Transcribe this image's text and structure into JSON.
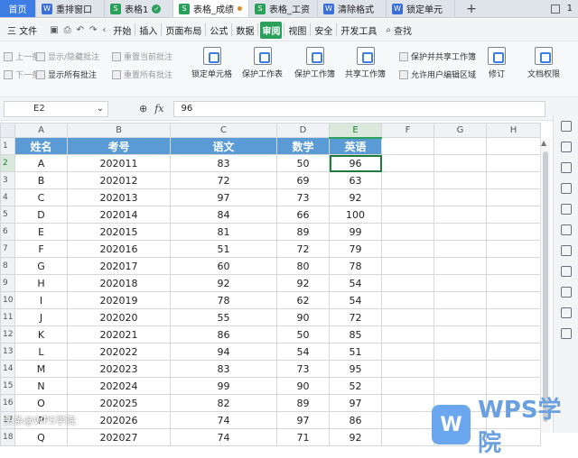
{
  "tabs": [
    {
      "label": "首页",
      "type": "home"
    },
    {
      "label": "重排窗口",
      "icon": "W",
      "kind": "w"
    },
    {
      "label": "表格1",
      "icon": "S",
      "kind": "s",
      "badge": "ok"
    },
    {
      "label": "表格_成绩",
      "icon": "S",
      "kind": "s",
      "active": true,
      "dot": true
    },
    {
      "label": "表格_工资",
      "icon": "S",
      "kind": "s"
    },
    {
      "label": "清除格式",
      "icon": "W",
      "kind": "w"
    },
    {
      "label": "锁定单元",
      "icon": "W",
      "kind": "w"
    }
  ],
  "tab_add": "+",
  "window_badge": "1",
  "menu": {
    "file": "三 文件",
    "items": [
      "开始",
      "插入",
      "页面布局",
      "公式",
      "数据",
      "审阅",
      "视图",
      "安全",
      "开发工具"
    ],
    "active": "审阅",
    "search": "查找"
  },
  "ribbon": {
    "small": [
      {
        "label": "上一条",
        "on": false
      },
      {
        "label": "下一条",
        "on": false
      },
      {
        "label": "显示/隐藏批注",
        "on": false
      },
      {
        "label": "显示所有批注",
        "on": true
      },
      {
        "label": "重置当前批注",
        "on": false
      },
      {
        "label": "重置所有批注",
        "on": false
      },
      {
        "label": "保护并共享工作簿",
        "on": true
      },
      {
        "label": "允许用户编辑区域",
        "on": true
      }
    ],
    "big": [
      "锁定单元格",
      "保护工作表",
      "保护工作簿",
      "共享工作簿",
      "修订",
      "文档权限"
    ]
  },
  "formula_bar": {
    "cell": "E2",
    "fx": "fx",
    "value": "96"
  },
  "columns": [
    "A",
    "B",
    "C",
    "D",
    "E",
    "F",
    "G",
    "H"
  ],
  "selected_col": "E",
  "headers": [
    "姓名",
    "考号",
    "语文",
    "数学",
    "英语"
  ],
  "rows": [
    [
      "A",
      "202011",
      "83",
      "50",
      "96"
    ],
    [
      "B",
      "202012",
      "72",
      "69",
      "63"
    ],
    [
      "C",
      "202013",
      "97",
      "73",
      "92"
    ],
    [
      "D",
      "202014",
      "84",
      "66",
      "100"
    ],
    [
      "E",
      "202015",
      "81",
      "89",
      "99"
    ],
    [
      "F",
      "202016",
      "51",
      "72",
      "79"
    ],
    [
      "G",
      "202017",
      "60",
      "80",
      "78"
    ],
    [
      "H",
      "202018",
      "92",
      "92",
      "54"
    ],
    [
      "I",
      "202019",
      "78",
      "62",
      "54"
    ],
    [
      "J",
      "202020",
      "55",
      "90",
      "72"
    ],
    [
      "K",
      "202021",
      "86",
      "50",
      "85"
    ],
    [
      "L",
      "202022",
      "94",
      "54",
      "51"
    ],
    [
      "M",
      "202023",
      "83",
      "73",
      "95"
    ],
    [
      "N",
      "202024",
      "99",
      "90",
      "52"
    ],
    [
      "O",
      "202025",
      "82",
      "89",
      "97"
    ],
    [
      "P",
      "202026",
      "74",
      "97",
      "86"
    ],
    [
      "Q",
      "202027",
      "74",
      "71",
      "92"
    ]
  ],
  "watermark": "头条@WPS学院",
  "brand": {
    "logo": "W",
    "name": "WPS学院"
  },
  "colors": {
    "accent": "#2aa05a",
    "header_fill": "#5b9bd5",
    "home_tab": "#3d7de4"
  }
}
